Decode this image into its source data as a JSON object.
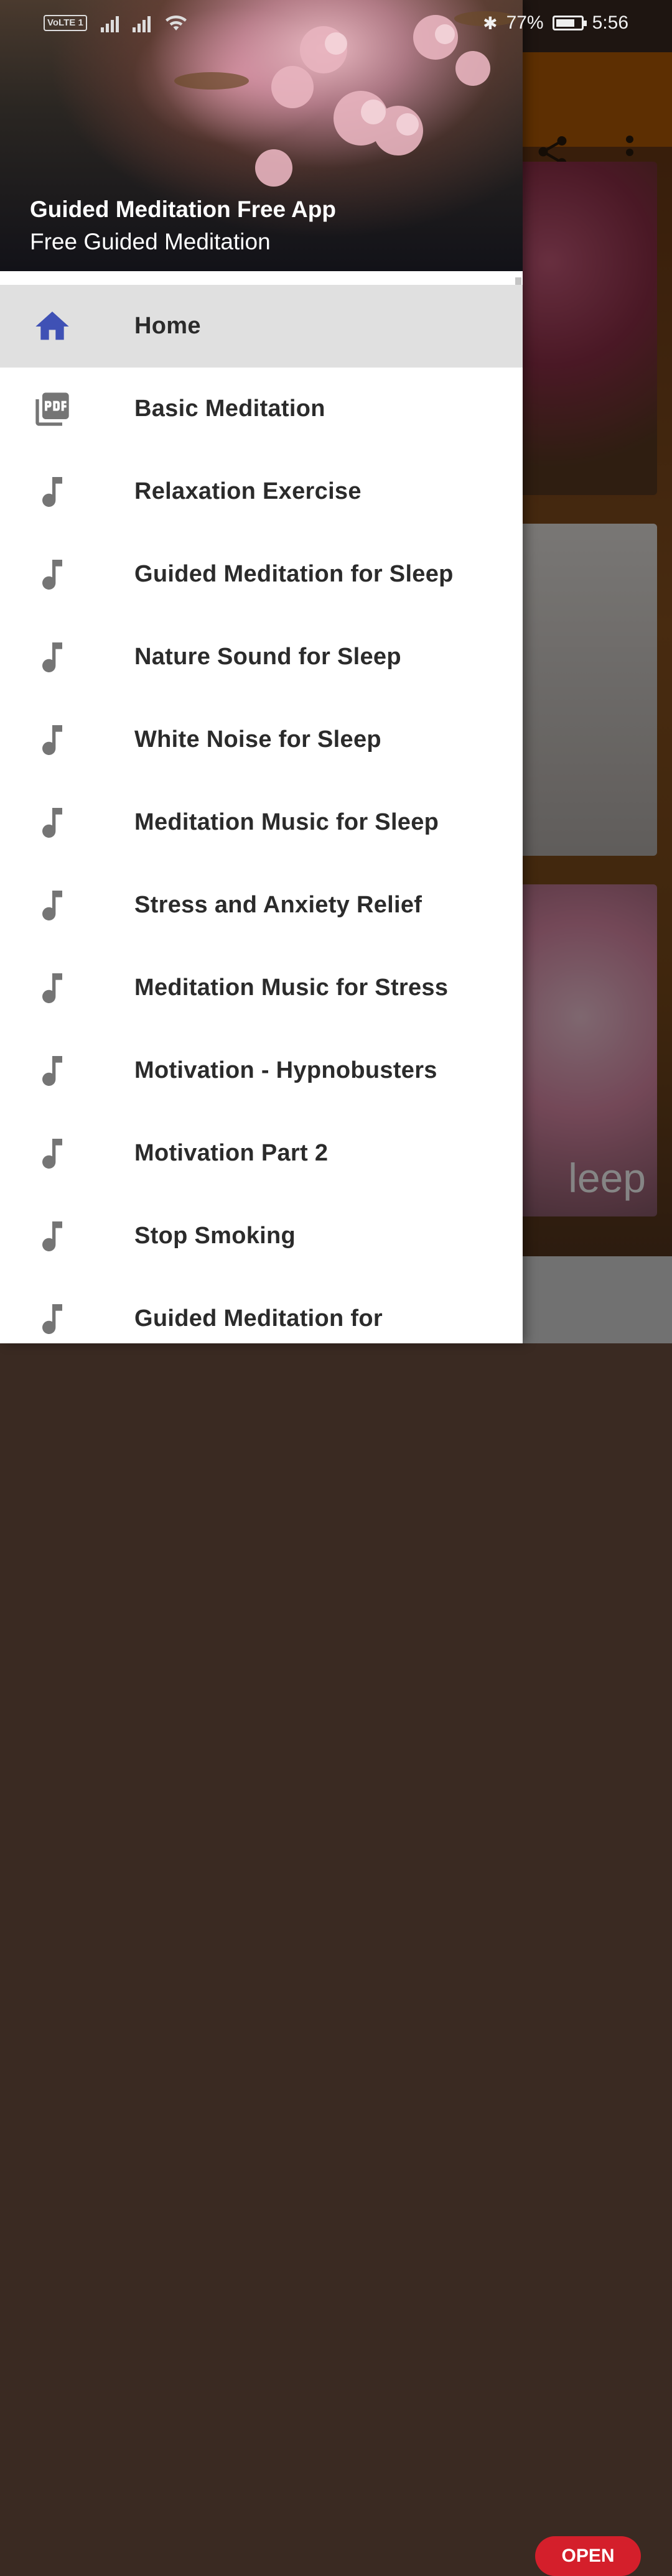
{
  "status_bar": {
    "volte": "VoLTE",
    "sim": "1",
    "battery_percent": "77%",
    "time": "5:56"
  },
  "drawer": {
    "title": "Guided Meditation Free App",
    "subtitle": "Free Guided Meditation",
    "items": [
      {
        "label": "Home",
        "icon": "home-icon",
        "selected": true
      },
      {
        "label": "Basic Meditation",
        "icon": "pdf-icon"
      },
      {
        "label": "Relaxation Exercise",
        "icon": "music-note-icon"
      },
      {
        "label": "Guided Meditation for Sleep",
        "icon": "music-note-icon"
      },
      {
        "label": "Nature Sound for Sleep",
        "icon": "music-note-icon"
      },
      {
        "label": "White Noise for Sleep",
        "icon": "music-note-icon"
      },
      {
        "label": "Meditation Music for Sleep",
        "icon": "music-note-icon"
      },
      {
        "label": "Stress and Anxiety Relief",
        "icon": "music-note-icon"
      },
      {
        "label": "Meditation Music for Stress",
        "icon": "music-note-icon"
      },
      {
        "label": "Motivation - Hypnobusters",
        "icon": "music-note-icon"
      },
      {
        "label": "Motivation Part 2",
        "icon": "music-note-icon"
      },
      {
        "label": "Stop Smoking",
        "icon": "music-note-icon"
      },
      {
        "label": "Guided Meditation for",
        "icon": "music-note-icon"
      }
    ]
  },
  "background": {
    "card_partial_text": "leep",
    "open_button": "OPEN"
  },
  "colors": {
    "selected_icon": "#3f51b5",
    "icon_gray": "#757575",
    "toolbar": "#b35a05",
    "open_button": "#d41f2b"
  }
}
